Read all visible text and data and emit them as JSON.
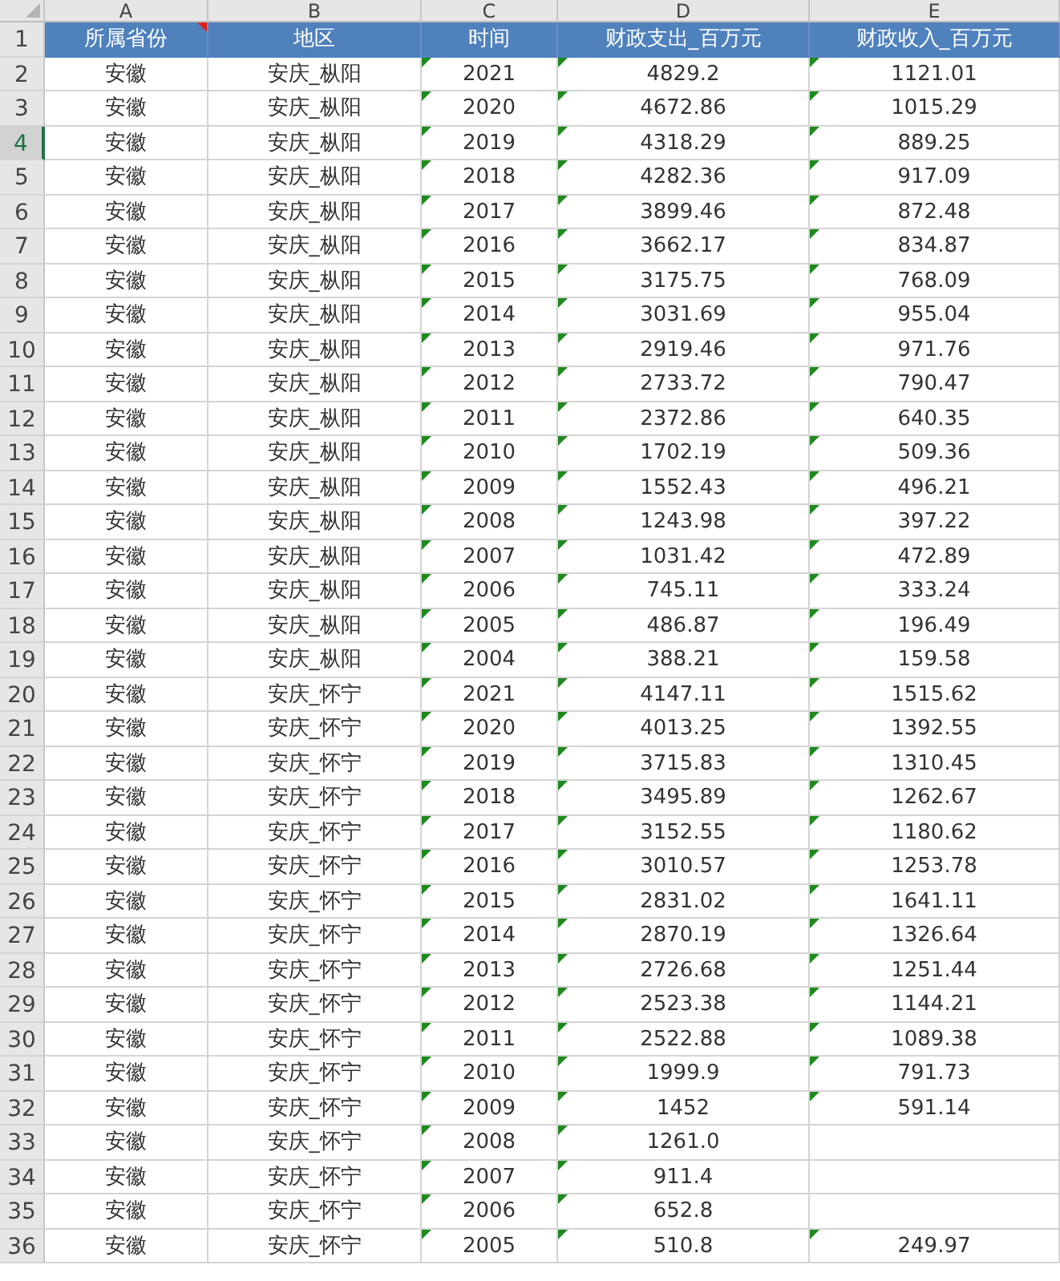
{
  "columns": [
    {
      "letter": "A",
      "selected": false,
      "flagged": false,
      "comment": true
    },
    {
      "letter": "B",
      "selected": false,
      "flagged": false,
      "comment": false
    },
    {
      "letter": "C",
      "selected": false,
      "flagged": true,
      "comment": false
    },
    {
      "letter": "D",
      "selected": false,
      "flagged": true,
      "comment": false
    },
    {
      "letter": "E",
      "selected": false,
      "flagged": true,
      "comment": false
    }
  ],
  "header_row": {
    "number": "1",
    "selected": false,
    "cells": [
      "所属省份",
      "地区",
      "时间",
      "财政支出_百万元",
      "财政收入_百万元"
    ]
  },
  "rows": [
    {
      "number": "2",
      "selected": false,
      "cells": [
        "安徽",
        "安庆_枞阳",
        "2021",
        "4829.2",
        "1121.01"
      ]
    },
    {
      "number": "3",
      "selected": false,
      "cells": [
        "安徽",
        "安庆_枞阳",
        "2020",
        "4672.86",
        "1015.29"
      ]
    },
    {
      "number": "4",
      "selected": true,
      "cells": [
        "安徽",
        "安庆_枞阳",
        "2019",
        "4318.29",
        "889.25"
      ]
    },
    {
      "number": "5",
      "selected": false,
      "cells": [
        "安徽",
        "安庆_枞阳",
        "2018",
        "4282.36",
        "917.09"
      ]
    },
    {
      "number": "6",
      "selected": false,
      "cells": [
        "安徽",
        "安庆_枞阳",
        "2017",
        "3899.46",
        "872.48"
      ]
    },
    {
      "number": "7",
      "selected": false,
      "cells": [
        "安徽",
        "安庆_枞阳",
        "2016",
        "3662.17",
        "834.87"
      ]
    },
    {
      "number": "8",
      "selected": false,
      "cells": [
        "安徽",
        "安庆_枞阳",
        "2015",
        "3175.75",
        "768.09"
      ]
    },
    {
      "number": "9",
      "selected": false,
      "cells": [
        "安徽",
        "安庆_枞阳",
        "2014",
        "3031.69",
        "955.04"
      ]
    },
    {
      "number": "10",
      "selected": false,
      "cells": [
        "安徽",
        "安庆_枞阳",
        "2013",
        "2919.46",
        "971.76"
      ]
    },
    {
      "number": "11",
      "selected": false,
      "cells": [
        "安徽",
        "安庆_枞阳",
        "2012",
        "2733.72",
        "790.47"
      ]
    },
    {
      "number": "12",
      "selected": false,
      "cells": [
        "安徽",
        "安庆_枞阳",
        "2011",
        "2372.86",
        "640.35"
      ]
    },
    {
      "number": "13",
      "selected": false,
      "cells": [
        "安徽",
        "安庆_枞阳",
        "2010",
        "1702.19",
        "509.36"
      ]
    },
    {
      "number": "14",
      "selected": false,
      "cells": [
        "安徽",
        "安庆_枞阳",
        "2009",
        "1552.43",
        "496.21"
      ]
    },
    {
      "number": "15",
      "selected": false,
      "cells": [
        "安徽",
        "安庆_枞阳",
        "2008",
        "1243.98",
        "397.22"
      ]
    },
    {
      "number": "16",
      "selected": false,
      "cells": [
        "安徽",
        "安庆_枞阳",
        "2007",
        "1031.42",
        "472.89"
      ]
    },
    {
      "number": "17",
      "selected": false,
      "cells": [
        "安徽",
        "安庆_枞阳",
        "2006",
        "745.11",
        "333.24"
      ]
    },
    {
      "number": "18",
      "selected": false,
      "cells": [
        "安徽",
        "安庆_枞阳",
        "2005",
        "486.87",
        "196.49"
      ]
    },
    {
      "number": "19",
      "selected": false,
      "cells": [
        "安徽",
        "安庆_枞阳",
        "2004",
        "388.21",
        "159.58"
      ]
    },
    {
      "number": "20",
      "selected": false,
      "cells": [
        "安徽",
        "安庆_怀宁",
        "2021",
        "4147.11",
        "1515.62"
      ]
    },
    {
      "number": "21",
      "selected": false,
      "cells": [
        "安徽",
        "安庆_怀宁",
        "2020",
        "4013.25",
        "1392.55"
      ]
    },
    {
      "number": "22",
      "selected": false,
      "cells": [
        "安徽",
        "安庆_怀宁",
        "2019",
        "3715.83",
        "1310.45"
      ]
    },
    {
      "number": "23",
      "selected": false,
      "cells": [
        "安徽",
        "安庆_怀宁",
        "2018",
        "3495.89",
        "1262.67"
      ]
    },
    {
      "number": "24",
      "selected": false,
      "cells": [
        "安徽",
        "安庆_怀宁",
        "2017",
        "3152.55",
        "1180.62"
      ]
    },
    {
      "number": "25",
      "selected": false,
      "cells": [
        "安徽",
        "安庆_怀宁",
        "2016",
        "3010.57",
        "1253.78"
      ]
    },
    {
      "number": "26",
      "selected": false,
      "cells": [
        "安徽",
        "安庆_怀宁",
        "2015",
        "2831.02",
        "1641.11"
      ]
    },
    {
      "number": "27",
      "selected": false,
      "cells": [
        "安徽",
        "安庆_怀宁",
        "2014",
        "2870.19",
        "1326.64"
      ]
    },
    {
      "number": "28",
      "selected": false,
      "cells": [
        "安徽",
        "安庆_怀宁",
        "2013",
        "2726.68",
        "1251.44"
      ]
    },
    {
      "number": "29",
      "selected": false,
      "cells": [
        "安徽",
        "安庆_怀宁",
        "2012",
        "2523.38",
        "1144.21"
      ]
    },
    {
      "number": "30",
      "selected": false,
      "cells": [
        "安徽",
        "安庆_怀宁",
        "2011",
        "2522.88",
        "1089.38"
      ]
    },
    {
      "number": "31",
      "selected": false,
      "cells": [
        "安徽",
        "安庆_怀宁",
        "2010",
        "1999.9",
        "791.73"
      ]
    },
    {
      "number": "32",
      "selected": false,
      "cells": [
        "安徽",
        "安庆_怀宁",
        "2009",
        "1452",
        "591.14"
      ]
    },
    {
      "number": "33",
      "selected": false,
      "cells": [
        "安徽",
        "安庆_怀宁",
        "2008",
        "1261.0",
        null
      ]
    },
    {
      "number": "34",
      "selected": false,
      "cells": [
        "安徽",
        "安庆_怀宁",
        "2007",
        "911.4",
        null
      ]
    },
    {
      "number": "35",
      "selected": false,
      "cells": [
        "安徽",
        "安庆_怀宁",
        "2006",
        "652.8",
        null
      ]
    },
    {
      "number": "36",
      "selected": false,
      "cells": [
        "安徽",
        "安庆_怀宁",
        "2005",
        "510.8",
        "249.97"
      ]
    }
  ]
}
